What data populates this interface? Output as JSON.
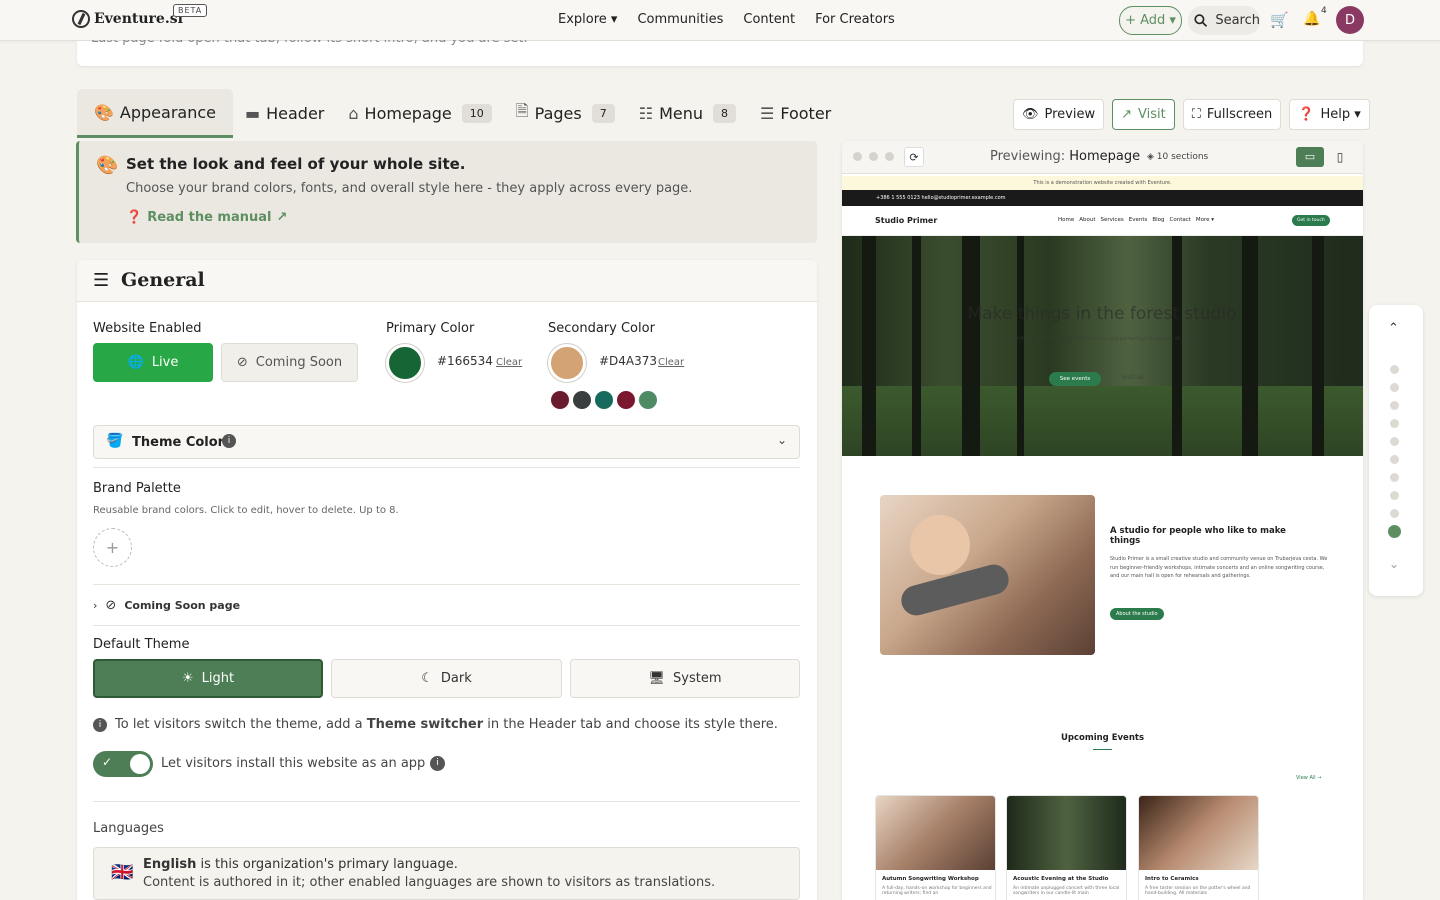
{
  "topnav": {
    "logo": "Eventure.si",
    "beta": "BETA",
    "links": [
      {
        "label": "Explore ▾"
      },
      {
        "label": "Communities"
      },
      {
        "label": "Content"
      },
      {
        "label": "For Creators"
      }
    ],
    "add": "+ Add ▾",
    "search": "Search",
    "notifications": "4",
    "avatar": "D"
  },
  "intro_text": "Last page fold open that tab, follow its short intro, and you are set.",
  "tabs": [
    {
      "label": "Appearance",
      "icon": "palette-icon"
    },
    {
      "label": "Header",
      "icon": "header-icon"
    },
    {
      "label": "Homepage",
      "count": "10",
      "icon": "home-icon"
    },
    {
      "label": "Pages",
      "count": "7",
      "icon": "file-icon"
    },
    {
      "label": "Menu",
      "count": "8",
      "icon": "sitemap-icon"
    },
    {
      "label": "Footer",
      "icon": "footer-icon"
    }
  ],
  "toolbar": {
    "preview": "Preview",
    "visit": "Visit",
    "fullscreen": "Fullscreen",
    "help": "Help ▾"
  },
  "info": {
    "title": "Set the look and feel of your whole site.",
    "subtitle": "Choose your brand colors, fonts, and overall style here - they apply across every page.",
    "link": "Read the manual"
  },
  "general": {
    "title": "General",
    "website_enabled": "Website Enabled",
    "live": "Live",
    "coming_soon": "Coming Soon",
    "primary_label": "Primary Color",
    "primary_hex": "#166534",
    "secondary_label": "Secondary Color",
    "secondary_hex": "#D4A373",
    "clear": "Clear",
    "palette_dots": [
      "#6b1b2e",
      "#3a3d3e",
      "#166b5e",
      "#7a1830",
      "#4e8a63"
    ],
    "theme_colors": "Theme Colors",
    "brand_palette": "Brand Palette",
    "brand_palette_help": "Reusable brand colors. Click to edit, hover to delete. Up to 8.",
    "coming_soon_page": "Coming Soon page",
    "default_theme": "Default Theme",
    "themes": {
      "light": "Light",
      "dark": "Dark",
      "system": "System"
    },
    "switch_note_a": "To let visitors switch the theme, add a ",
    "switch_note_b": "Theme switcher",
    "switch_note_c": " in the Header tab and choose its style there.",
    "install_label": "Let visitors install this website as an app",
    "languages": "Languages",
    "lang_primary": "English",
    "lang_primary_suffix": " is this organization's primary language.",
    "lang_note": "Content is authored in it; other enabled languages are shown to visitors as translations."
  },
  "preview": {
    "previewing": "Previewing: ",
    "page": "Homepage",
    "sections": "10 sections",
    "demo_notice": "This is a demonstration website created with Eventure.",
    "contact": "+386 1 555 0123   hello@studioprimer.example.com",
    "site_name": "Studio Primer",
    "site_nav": [
      "Home",
      "About",
      "Services",
      "Events",
      "Blog",
      "Contact",
      "More ▾"
    ],
    "cta": "Get in touch",
    "hero_title": "Make things in the forest studio",
    "hero_sub": "Songwriting workshops, intimate concerts and gatherings for people of all ages.",
    "hero_btn": "See events",
    "hero_btn2": "Visit us",
    "about_title": "A studio for people who like to make things",
    "about_body": "Studio Primer is a small creative studio and community venue on Trubarjeva cesta. We run beginner-friendly workshops, intimate concerts and an online songwriting course, and our main hall is open for rehearsals and gatherings.",
    "about_btn": "About the studio",
    "events_title": "Upcoming Events",
    "view_all": "View All →",
    "events": [
      {
        "title": "Autumn Songwriting Workshop",
        "desc": "A full-day, hands-on workshop for beginners and returning writers; find an"
      },
      {
        "title": "Acoustic Evening at the Studio",
        "desc": "An intimate unplugged concert with three local songwriters in our candle-lit main"
      },
      {
        "title": "Intro to Ceramics",
        "desc": "A free taster session on the potter's wheel and hand-building. All materials"
      }
    ]
  }
}
